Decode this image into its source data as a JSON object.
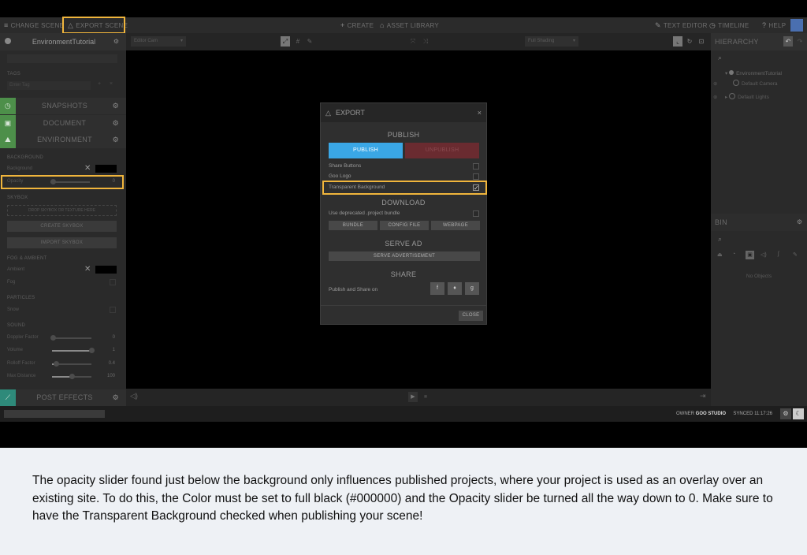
{
  "topbar": {
    "change_scene": "CHANGE SCENE",
    "export_scene": "EXPORT SCENE",
    "create": "CREATE",
    "asset_library": "ASSET LIBRARY",
    "text_editor": "TEXT EDITOR",
    "timeline": "TIMELINE",
    "help": "HELP"
  },
  "left": {
    "scene_name": "EnvironmentTutorial",
    "tags_label": "TAGS",
    "tags_placeholder": "Enter Tag",
    "snapshots": "SNAPSHOTS",
    "document": "DOCUMENT",
    "environment": "ENVIRONMENT",
    "background_header": "BACKGROUND",
    "background_label": "Background",
    "opacity_label": "Opacity",
    "opacity_value": "0",
    "skybox_header": "SKYBOX",
    "skybox_drop": "DROP SKYBOX OR TEXTURE HERE",
    "create_skybox": "CREATE SKYBOX",
    "import_skybox": "IMPORT SKYBOX",
    "fog_header": "FOG & AMBIENT",
    "ambient_label": "Ambient",
    "fog_label": "Fog",
    "particles_header": "PARTICLES",
    "snow_label": "Snow",
    "sound_header": "SOUND",
    "doppler_label": "Doppler Factor",
    "doppler_value": "0",
    "volume_label": "Volume",
    "volume_value": "1",
    "volume_level": 1,
    "rolloff_label": "Rolloff Factor",
    "rolloff_value": "0.4",
    "rolloff_level": 0.1,
    "maxdist_label": "Max Distance",
    "maxdist_value": "100",
    "maxdist_level": 0.5,
    "post_effects": "POST EFFECTS"
  },
  "viewport": {
    "camera": "Editor Cam",
    "shading": "Full Shading"
  },
  "right": {
    "hierarchy": "HIERARCHY",
    "root": "EnvironmentTutorial",
    "camera": "Default Camera",
    "lights": "Default Lights",
    "bin": "BIN",
    "no_objects": "No Objects"
  },
  "modal": {
    "title": "EXPORT",
    "close_x": "×",
    "publish_section": "PUBLISH",
    "publish": "PUBLISH",
    "unpublish": "UNPUBLISH",
    "share_buttons": "Share Buttons",
    "goo_logo": "Goo Logo",
    "transparent_bg": "Transparent Background",
    "transparent_checked": true,
    "download_section": "DOWNLOAD",
    "deprecated_bundle": "Use deprecated .project bundle",
    "bundle": "BUNDLE",
    "config_file": "CONFIG FILE",
    "webpage": "WEBPAGE",
    "serve_ad_section": "SERVE AD",
    "serve_ad": "SERVE ADVERTISEMENT",
    "share_section": "SHARE",
    "publish_share": "Publish and Share on",
    "close": "CLOSE"
  },
  "status": {
    "owner_label": "OWNER",
    "owner": "GOO STUDIO",
    "synced": "SYNCED 11:17:26"
  },
  "colors": {
    "highlight": "#f0b53c",
    "publish_blue": "#3aa7e6",
    "unpublish_red": "#6a2b30",
    "side_green": "#4d8f4a",
    "side_teal": "#2e8a7a"
  },
  "caption": "The opacity slider found just below the background only influences published projects, where your project is used as an overlay over an existing site. To do this, the Color must be set to full black (#000000) and the Opacity slider be turned all the way down to 0. Make sure to have the Transparent Background checked when publishing your scene!"
}
